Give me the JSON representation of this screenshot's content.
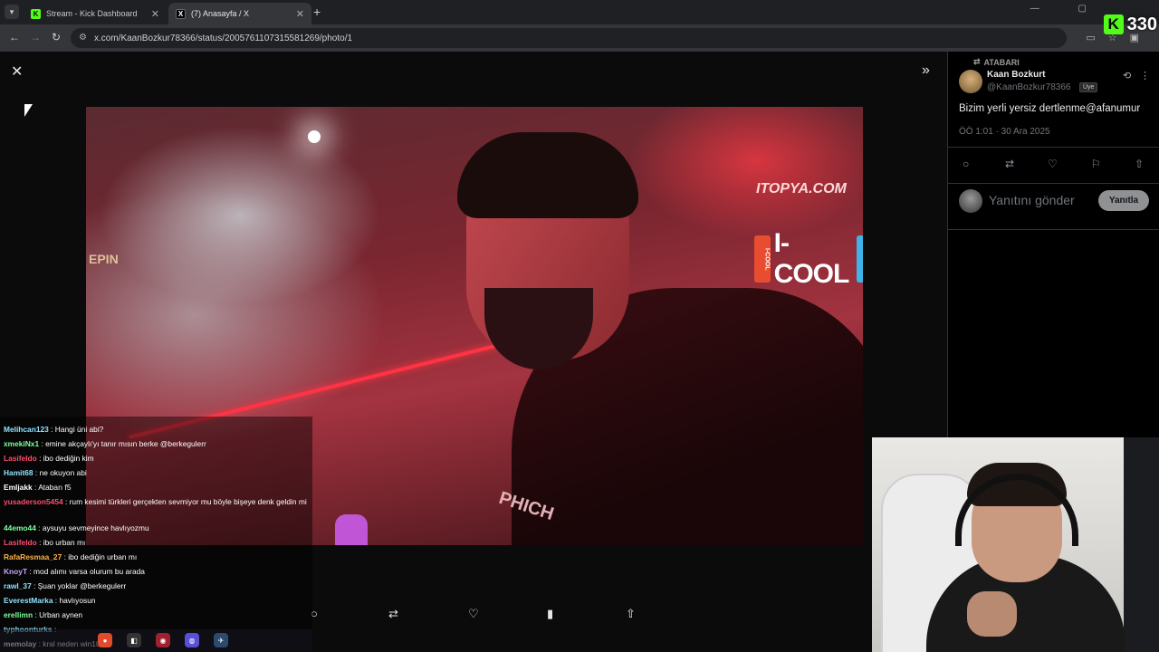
{
  "browser": {
    "tabs": [
      {
        "label": "Stream - Kick Dashboard",
        "favicon": "kick-icon",
        "active": false
      },
      {
        "label": "(7) Anasayfa / X",
        "favicon": "x-logo-icon",
        "active": true
      }
    ],
    "url": "x.com/KaanBozkur78366/status/2005761107315581269/photo/1"
  },
  "kick_overlay": {
    "viewer_count": "330"
  },
  "photo": {
    "watermarks": {
      "itopya": "ITOPYA.COM",
      "icool": "I-COOL",
      "can_label": "I-COOL",
      "epin": "EPIN",
      "jacket": "PHICH"
    }
  },
  "tweet": {
    "repost_label": "ATABARI",
    "author_name": "Kaan Bozkurt",
    "author_handle": "@KaanBozkur78366",
    "badge": "Üye",
    "text": "Bizim yerli yersiz dertlenme@afanumur",
    "time": "ÖÖ 1:01 · 30 Ara 2025",
    "reply_placeholder": "Yanıtını gönder",
    "reply_button": "Yanıtla"
  },
  "chat": [
    {
      "user": "Melihcan123",
      "color": "#8fe3ff",
      "msg": "Hangi üni abi?"
    },
    {
      "user": "xmekiNx1",
      "color": "#7dff9a",
      "msg": "emine akçaylı'yı tanır mısın berke @berkegulerr"
    },
    {
      "user": "Lasifeldo",
      "color": "#ff4d6d",
      "msg": "ibo dediğin kim"
    },
    {
      "user": "Hamit68",
      "color": "#8fe3ff",
      "msg": "ne okuyon abi"
    },
    {
      "user": "Emljakk",
      "color": "#ffffff",
      "msg": "Atabarı f5"
    },
    {
      "user": "yusaderson5454",
      "color": "#ff4d6d",
      "msg": "rum kesimi türkleri gerçekten sevmiyor mu böyle bişeye denk geldin mi"
    },
    {
      "user": "44emo44",
      "color": "#7dff9a",
      "msg": "aysuyu sevmeyince havlıyozmu"
    },
    {
      "user": "Lasifeldo",
      "color": "#ff4d6d",
      "msg": "ibo urban mı"
    },
    {
      "user": "RafaResmaa_27",
      "color": "#ffb347",
      "msg": "ibo dediğin urban mı"
    },
    {
      "user": "KnoyT",
      "color": "#c8a2ff",
      "msg": "mod alımı varsa olurum bu arada"
    },
    {
      "user": "rawl_37",
      "color": "#8fe3ff",
      "msg": "Şuan yoklar @berkegulerr"
    },
    {
      "user": "EverestMarka",
      "color": "#8fe3ff",
      "msg": "havlıyosun"
    },
    {
      "user": "erellimn",
      "color": "#7dff9a",
      "msg": "Urban aynen"
    },
    {
      "user": "typhoonturks",
      "color": "#8fe3ff",
      "msg": ""
    },
    {
      "user": "memolay",
      "color": "#ffffff",
      "msg": "kral neden win10"
    }
  ],
  "colors": {
    "kick_green": "#53fc18",
    "x_bg": "#000000",
    "chrome_bg": "#35363a"
  },
  "icons": {
    "close": "✕",
    "expand": "»",
    "reply": "○",
    "repost": "⇄",
    "like": "♡",
    "views": "▮",
    "share": "⇧",
    "bookmark": "⚐",
    "grok": "⟲",
    "more": "⋮"
  }
}
